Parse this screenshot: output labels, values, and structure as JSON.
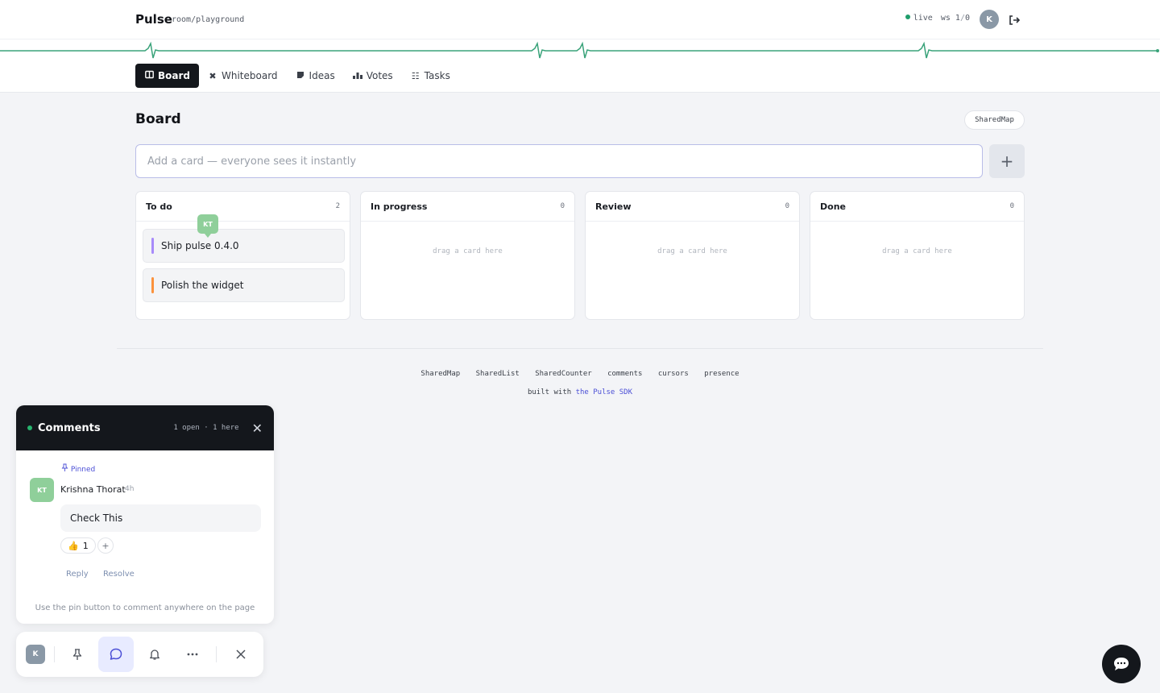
{
  "header": {
    "brand": "Pulse",
    "room": "room/playground",
    "status_live": "live",
    "status_ws": "ws",
    "status_count_a": "1",
    "status_count_b": "0",
    "avatar_initial": "K"
  },
  "tabs": [
    {
      "label": "Board",
      "icon": "board-icon",
      "active": true
    },
    {
      "label": "Whiteboard",
      "icon": "tools-icon",
      "active": false
    },
    {
      "label": "Ideas",
      "icon": "note-icon",
      "active": false
    },
    {
      "label": "Votes",
      "icon": "votes-icon",
      "active": false
    },
    {
      "label": "Tasks",
      "icon": "tasks-icon",
      "active": false
    }
  ],
  "board": {
    "title": "Board",
    "badge": "SharedMap",
    "input_placeholder": "Add a card — everyone sees it instantly",
    "add_label": "+",
    "columns": [
      {
        "title": "To do",
        "count": "2",
        "empty": ""
      },
      {
        "title": "In progress",
        "count": "0",
        "empty": "drag a card here"
      },
      {
        "title": "Review",
        "count": "0",
        "empty": "drag a card here"
      },
      {
        "title": "Done",
        "count": "0",
        "empty": "drag a card here"
      }
    ],
    "cards": [
      {
        "text": "Ship pulse 0.4.0",
        "color": "#a78bfa"
      },
      {
        "text": "Polish the widget",
        "color": "#fb923c"
      }
    ],
    "presence_initials": "KT"
  },
  "footer": {
    "links": [
      "SharedMap",
      "SharedList",
      "SharedCounter",
      "comments",
      "cursors",
      "presence"
    ],
    "built_prefix": "built with",
    "built_link": "the Pulse SDK"
  },
  "comments": {
    "title": "Comments",
    "meta": "1 open · 1 here",
    "pinned": "Pinned",
    "author_initials": "KT",
    "author": "Krishna Thorat",
    "time": "4h",
    "body": "Check This",
    "reaction_emoji": "👍",
    "reaction_count": "1",
    "reaction_add": "+",
    "reply": "Reply",
    "resolve": "Resolve",
    "hint": "Use the pin button to comment anywhere on the page"
  },
  "toolbar": {
    "avatar_initial": "K",
    "items": [
      "pin-icon",
      "comment-icon",
      "bell-icon",
      "more-icon",
      "close-icon"
    ]
  },
  "colors": {
    "accent": "#4b4fd6",
    "live": "#1f9d6b",
    "dark": "#14171c",
    "pulse_line": "#3aa37a"
  }
}
